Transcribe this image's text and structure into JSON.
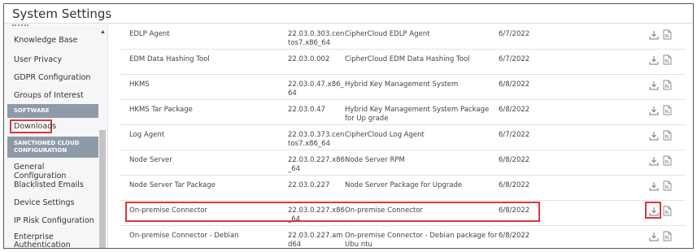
{
  "window": {
    "title": "System Settings"
  },
  "sidebar": {
    "items_top": [
      {
        "label": "Knowledge Base"
      },
      {
        "label": "User Privacy"
      },
      {
        "label": "GDPR Configuration"
      },
      {
        "label": "Groups of Interest"
      }
    ],
    "section_software": "SOFTWARE",
    "downloads_label": "Downloads",
    "section_sanctioned": "SANCTIONED CLOUD CONFIGURATION",
    "items_bottom": [
      {
        "label": "General Configuration"
      },
      {
        "label": "Blacklisted Emails"
      },
      {
        "label": "Device Settings"
      },
      {
        "label": "IP Risk Configuration"
      },
      {
        "label": "Enterprise Authentication"
      }
    ]
  },
  "downloads": {
    "rows": [
      {
        "name": "EDLP Agent",
        "version": "22.03.0.303.cen tos7.x86_64",
        "description": "CipherCloud EDLP Agent",
        "date": "6/7/2022"
      },
      {
        "name": "EDM Data Hashing Tool",
        "version": "22.03.0.002",
        "description": "CipherCloud EDM Data Hashing Tool",
        "date": "6/7/2022"
      },
      {
        "name": "HKMS",
        "version": "22.03.0.47.x86_ 64",
        "description": "Hybrid Key Management System",
        "date": "6/8/2022"
      },
      {
        "name": "HKMS Tar Package",
        "version": "22.03.0.47",
        "description": "Hybrid Key Management System Package for Up grade",
        "date": "6/8/2022"
      },
      {
        "name": "Log Agent",
        "version": "22.03.0.373.cen tos7.x86_64",
        "description": "CipherCloud Log Agent",
        "date": "6/7/2022"
      },
      {
        "name": "Node Server",
        "version": "22.03.0.227.x86 _64",
        "description": "Node Server RPM",
        "date": "6/8/2022"
      },
      {
        "name": "Node Server Tar Package",
        "version": "22.03.0.227",
        "description": "Node Server Package for Upgrade",
        "date": "6/8/2022"
      },
      {
        "name": "On-premise Connector",
        "version": "22.03.0.227.x86 _64",
        "description": "On-premise Connector",
        "date": "6/8/2022"
      },
      {
        "name": "On-premise Connector - Debian",
        "version": "22.03.0.227.am d64",
        "description": "On-premise Connector - Debian package for Ubu ntu",
        "date": "6/8/2022"
      }
    ],
    "icons": {
      "download": "download-icon",
      "file": "file-icon"
    }
  },
  "colors": {
    "highlight": "#d9363e",
    "section_header": "#8e9aa7",
    "sidebar_bg": "#f5f6f7"
  }
}
